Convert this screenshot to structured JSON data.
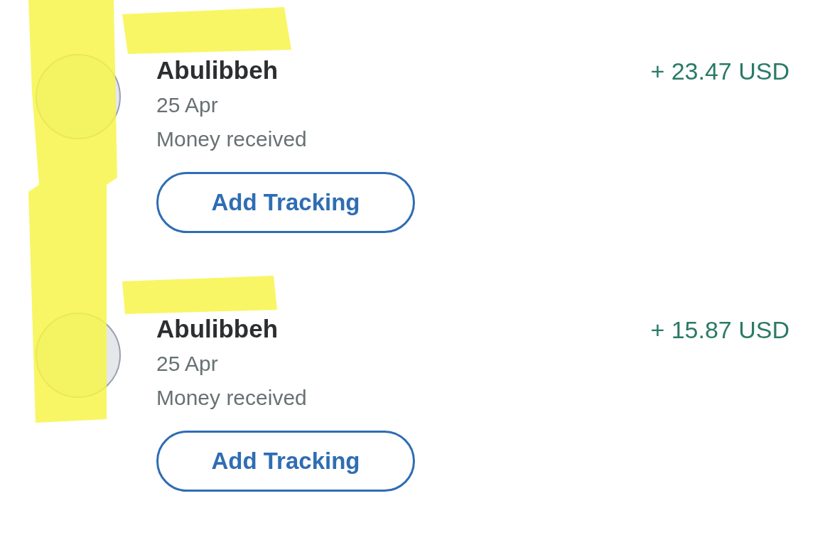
{
  "transactions": [
    {
      "name": "Abulibbeh",
      "date": "25 Apr",
      "status": "Money received",
      "amount": "+ 23.47 USD",
      "button": "Add Tracking"
    },
    {
      "name": "Abulibbeh",
      "date": "25 Apr",
      "status": "Money received",
      "amount": "+ 15.87 USD",
      "button": "Add Tracking"
    }
  ]
}
